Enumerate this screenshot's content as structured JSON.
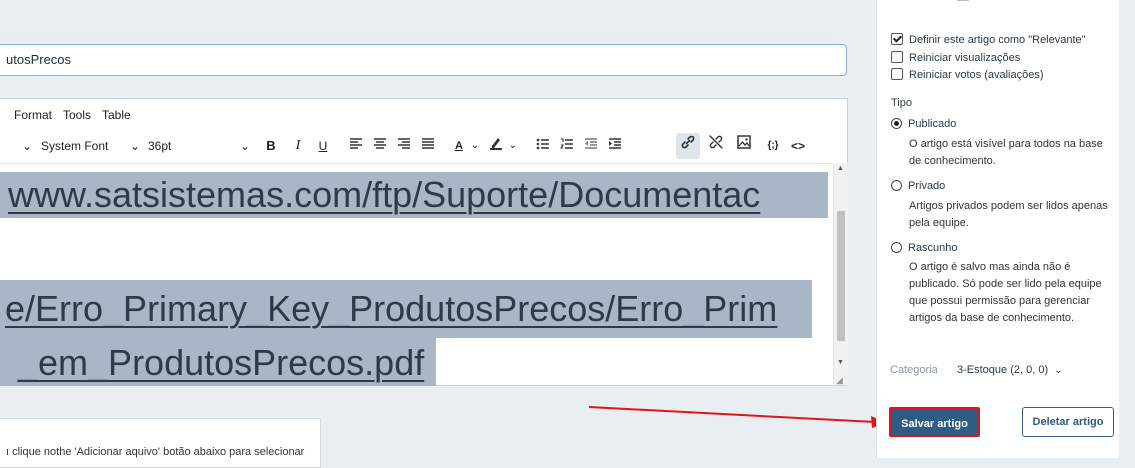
{
  "title_field": {
    "value": "utosPrecos"
  },
  "editor": {
    "menu": [
      "Format",
      "Tools",
      "Table"
    ],
    "toolbar": {
      "font_family": "System Font",
      "font_size": "36pt",
      "bold": "B",
      "italic": "I",
      "underline": "U",
      "text_color": "A",
      "source_code": "<>",
      "template": "{;}"
    },
    "content_lines": [
      "www.satsistemas.com/ftp/Suporte/Documentac",
      "e/Erro_Primary_Key_ProdutosPrecos/Erro_Prim",
      "_em_ProdutosPrecos.pdf"
    ]
  },
  "attachment": {
    "instruction": "ı clique nothe 'Adicionar aquivo' botão abaixo para selecionar"
  },
  "sidebar": {
    "checkboxes": [
      {
        "label": "Definir este artigo como \"Relevante\"",
        "checked": true
      },
      {
        "label": "Reiniciar visualizações",
        "checked": false
      },
      {
        "label": "Reiniciar votos (avaliações)",
        "checked": false
      }
    ],
    "type_label": "Tipo",
    "types": [
      {
        "label": "Publicado",
        "selected": true,
        "description": "O artigo está visível para todos na base de conhecimento."
      },
      {
        "label": "Privado",
        "selected": false,
        "description": "Artigos privados podem ser lidos apenas pela equipe."
      },
      {
        "label": "Rascunho",
        "selected": false,
        "description": "O artigo é salvo mas ainda não é publicado. Só pode ser lido pela equipe que possui permissão para gerenciar artigos da base de conhecimento."
      }
    ],
    "category_label": "Categoria",
    "category_value": "3-Estoque (2, 0, 0)"
  },
  "actions": {
    "save": "Salvar artigo",
    "delete": "Deletar artigo"
  },
  "colors": {
    "primary": "#2e5c86",
    "annotation": "#e1141b",
    "selection": "#a9b6c5"
  }
}
